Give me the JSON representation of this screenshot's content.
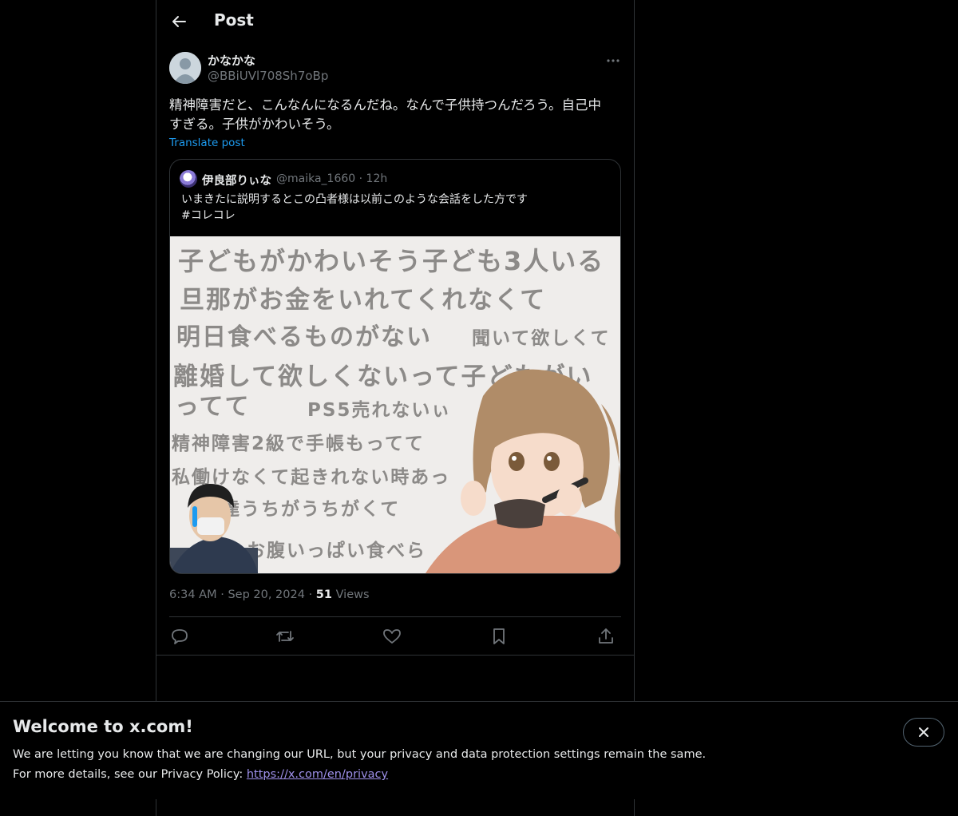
{
  "header": {
    "title": "Post",
    "back_icon": "arrow-left-icon"
  },
  "post": {
    "author_name": "かなかな",
    "author_handle": "@BBiUVl708Sh7oBp",
    "text_line1": "精神障害だと、こんなんになるんだね。なんで子供持つんだろう。自己中",
    "text_line2": "すぎる。子供がかわいそう。",
    "translate_label": "Translate post",
    "time": "6:34 AM",
    "date": "Sep 20, 2024",
    "views_count": "51",
    "views_label": "Views",
    "separator": "·"
  },
  "quote": {
    "author_name": "伊良部りぃな",
    "author_handle": "@maika_1660",
    "age": "12h",
    "separator": "·",
    "text_line1": "いまきたに説明するとこの凸者様は以前このような会話をした方です",
    "text_line2": "#コレコレ",
    "image_lines": [
      "子どもがかわいそう子ども3人いる",
      "旦那がお金をいれてくれなくて",
      "明日食べるものがない",
      "聞いて欲しくて",
      "離婚して欲しくないって子どもがい",
      "ってて",
      "PS5売れないぃ",
      "精神障害2級で手帳もってて",
      "私働けなくて起きれない時あっ",
      "達うちがうちがくて",
      "お腹いっぱい食べら"
    ]
  },
  "actions": {
    "reply_icon": "reply-icon",
    "retweet_icon": "retweet-icon",
    "like_icon": "heart-icon",
    "bookmark_icon": "bookmark-icon",
    "share_icon": "share-icon"
  },
  "banner": {
    "title": "Welcome to x.com!",
    "text_line1": "We are letting you know that we are changing our URL, but your privacy and data protection settings remain the same.",
    "text_line2_prefix": "For more details, see our Privacy Policy: ",
    "link_text": "https://x.com/en/privacy"
  },
  "colors": {
    "background": "#000000",
    "primary_text": "#e7e9ea",
    "secondary_text": "#71767b",
    "accent_blue": "#1d9bf0",
    "border": "#2f3336",
    "link_purple": "#9d8fe8"
  }
}
